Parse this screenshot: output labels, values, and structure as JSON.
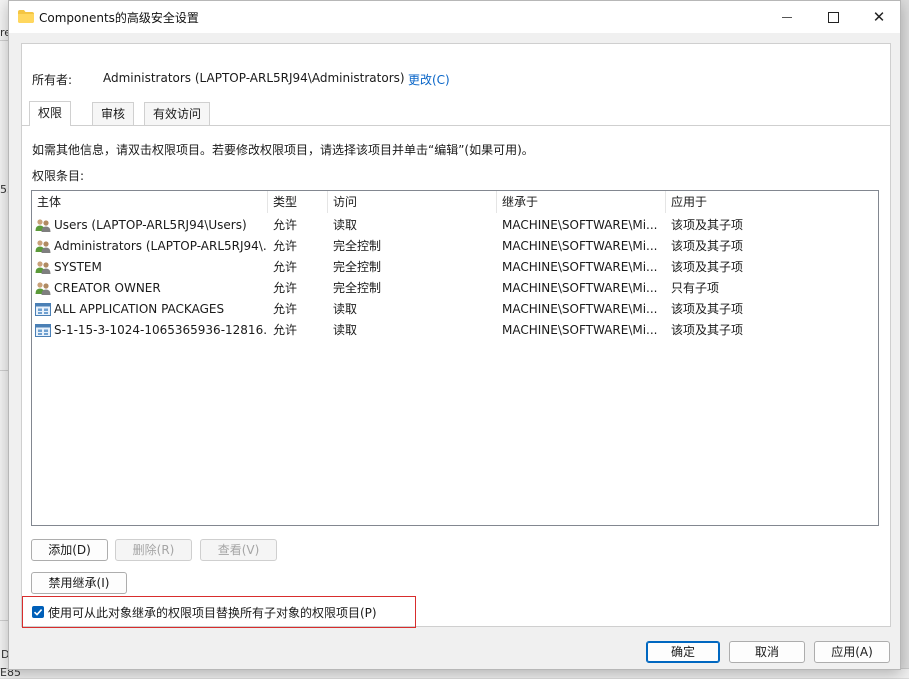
{
  "background": {
    "frag1": "re",
    "frag2": "55",
    "frag3": "D",
    "frag4": "E85"
  },
  "window": {
    "title": "Components的高级安全设置",
    "folder_icon": "folder-icon"
  },
  "owner": {
    "label": "所有者:",
    "value": "Administrators (LAPTOP-ARL5RJ94\\Administrators)",
    "change_link": "更改(C)"
  },
  "tabs": [
    "权限",
    "审核",
    "有效访问"
  ],
  "info_text": "如需其他信息，请双击权限项目。若要修改权限项目，请选择该项目并单击“编辑”(如果可用)。",
  "entries_label": "权限条目:",
  "table": {
    "columns": [
      "主体",
      "类型",
      "访问",
      "继承于",
      "应用于"
    ],
    "rows": [
      {
        "principal": "Users (LAPTOP-ARL5RJ94\\Users)",
        "type": "允许",
        "access": "读取",
        "inherited": "MACHINE\\SOFTWARE\\Mi...",
        "applies": "该项及其子项",
        "icon": "user-group-icon"
      },
      {
        "principal": "Administrators (LAPTOP-ARL5RJ94\\...",
        "type": "允许",
        "access": "完全控制",
        "inherited": "MACHINE\\SOFTWARE\\Mi...",
        "applies": "该项及其子项",
        "icon": "user-group-icon"
      },
      {
        "principal": "SYSTEM",
        "type": "允许",
        "access": "完全控制",
        "inherited": "MACHINE\\SOFTWARE\\Mi...",
        "applies": "该项及其子项",
        "icon": "user-group-icon"
      },
      {
        "principal": "CREATOR OWNER",
        "type": "允许",
        "access": "完全控制",
        "inherited": "MACHINE\\SOFTWARE\\Mi...",
        "applies": "只有子项",
        "icon": "user-group-icon"
      },
      {
        "principal": "ALL APPLICATION PACKAGES",
        "type": "允许",
        "access": "读取",
        "inherited": "MACHINE\\SOFTWARE\\Mi...",
        "applies": "该项及其子项",
        "icon": "app-package-icon"
      },
      {
        "principal": "S-1-15-3-1024-1065365936-12816...",
        "type": "允许",
        "access": "读取",
        "inherited": "MACHINE\\SOFTWARE\\Mi...",
        "applies": "该项及其子项",
        "icon": "app-package-icon"
      }
    ]
  },
  "buttons": {
    "add": "添加(D)",
    "remove": "删除(R)",
    "view": "查看(V)",
    "disable_inheritance": "禁用继承(I)",
    "ok": "确定",
    "cancel": "取消",
    "apply": "应用(A)"
  },
  "replace_checkbox": {
    "label": "使用可从此对象继承的权限项目替换所有子对象的权限项目(P)",
    "checked": true
  },
  "colors": {
    "link": "#0a66c8",
    "accent": "#005fb8",
    "highlight_border": "#d82d2d"
  }
}
